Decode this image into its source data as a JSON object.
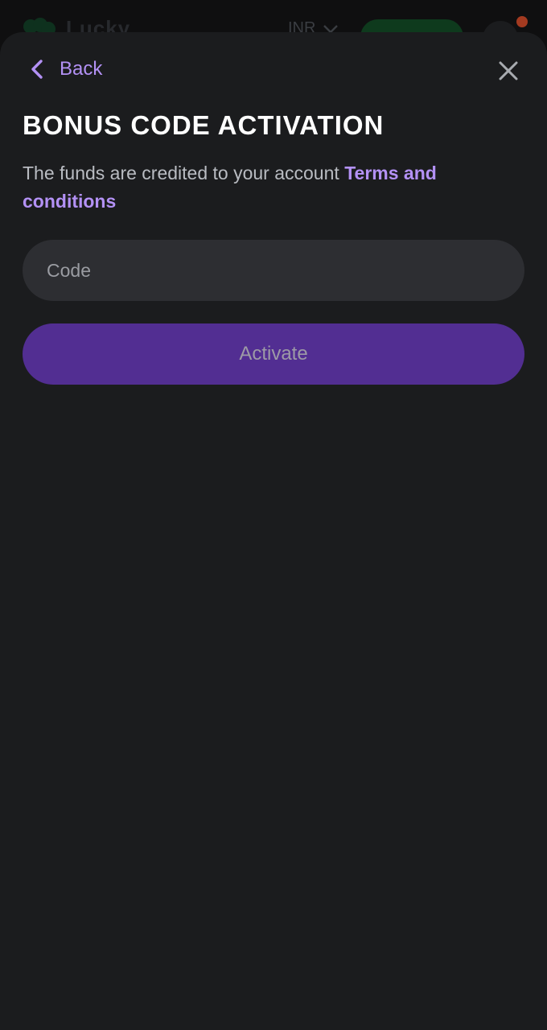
{
  "background_header": {
    "logo_text": "Lucky",
    "currency": "INR"
  },
  "modal": {
    "back_label": "Back",
    "title": "BONUS CODE ACTIVATION",
    "description": "The funds are credited to your account ",
    "terms_link": "Terms and conditions",
    "code_input": {
      "placeholder": "Code",
      "value": ""
    },
    "activate_label": "Activate"
  },
  "colors": {
    "accent": "#b391f5",
    "button": "#522e92",
    "sheet_bg": "#1b1c1e",
    "input_bg": "#2d2e32"
  },
  "icons": {
    "back": "chevron-left-icon",
    "close": "close-icon",
    "currency_dropdown": "chevron-down-icon",
    "logo": "clover-icon"
  }
}
